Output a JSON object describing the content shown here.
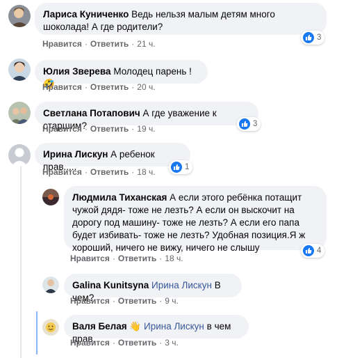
{
  "actions": {
    "like": "Нравится",
    "reply": "Ответить"
  },
  "comments": [
    {
      "author": "Лариса Куниченко",
      "text": "Ведь нельзя малым детям много шоколада! А где родители?",
      "time": "21 ч.",
      "reactions": "3"
    },
    {
      "author": "Юлия Зверева",
      "text": "Молодец парень ! 🤣",
      "time": "20 ч."
    },
    {
      "author": "Светлана Потапович",
      "text": "А где уважение к старшим?",
      "time": "19 ч.",
      "reactions": "3"
    },
    {
      "author": "Ирина Лискун",
      "text": "А ребенок прав.....",
      "time": "18 ч.",
      "reactions": "1"
    },
    {
      "author": "Людмила Тиханская",
      "text": "А если этого ребёнка потащит чужой дядя- тоже не лезть? А если он выскочит на дорогу под машину- тоже не лезть? А если его папа будет избивать- тоже не лезть? Удобная позиция.Я ж хороший, ничего не вижу, ничего не слышу",
      "time": "18 ч.",
      "reactions": "4"
    },
    {
      "author": "Galina Kunitsyna",
      "mention": "Ирина Лискун",
      "text": "В чем?",
      "time": "9 ч."
    },
    {
      "author": "Валя Белая",
      "badge": "👋",
      "mention": "Ирина Лискун",
      "text": "в чем прав.",
      "time": "3 ч."
    }
  ],
  "colors": {
    "bubble": "#f0f2f5",
    "meta": "#65676b",
    "mention": "#385898",
    "like": "#1877f2"
  }
}
